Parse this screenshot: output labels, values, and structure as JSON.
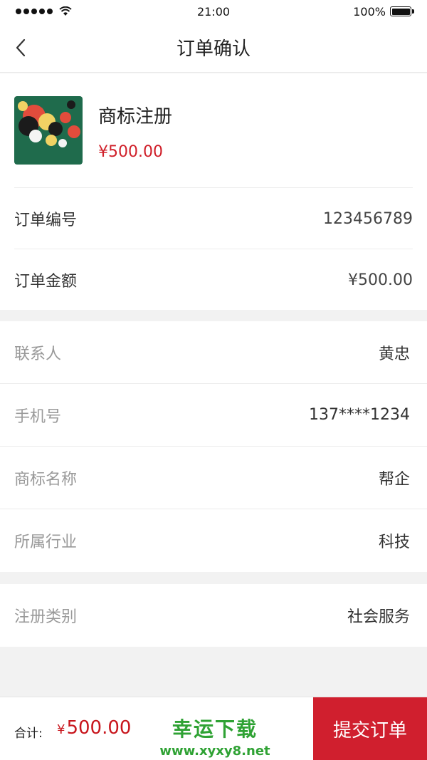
{
  "status": {
    "time": "21:00",
    "battery": "100%"
  },
  "nav": {
    "title": "订单确认"
  },
  "product": {
    "name": "商标注册",
    "price": "¥500.00"
  },
  "order": {
    "number_label": "订单编号",
    "number_value": "123456789",
    "amount_label": "订单金额",
    "amount_value": "¥500.00"
  },
  "info": [
    {
      "label": "联系人",
      "value": "黄忠"
    },
    {
      "label": "手机号",
      "value": "137****1234"
    },
    {
      "label": "商标名称",
      "value": "帮企"
    },
    {
      "label": "所属行业",
      "value": "科技"
    }
  ],
  "category": {
    "label": "注册类别",
    "value": "社会服务"
  },
  "bottom": {
    "total_label": "合计:",
    "currency": "¥",
    "total_value": "500.00",
    "submit_label": "提交订单"
  },
  "watermark": {
    "title": "幸运下载",
    "url": "www.xyxy8.net"
  },
  "colors": {
    "accent": "#d01f2e",
    "price": "#d0202a",
    "watermark": "#2fa234"
  }
}
